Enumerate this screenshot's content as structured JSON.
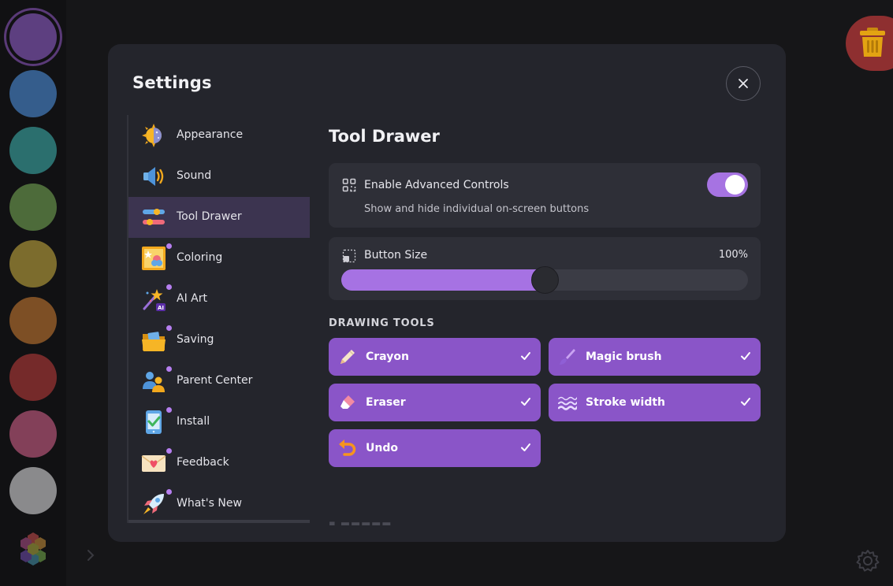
{
  "palette": {
    "swatches": [
      {
        "name": "purple",
        "color": "#5d3f80",
        "selected": true
      },
      {
        "name": "blue",
        "color": "#355d8c"
      },
      {
        "name": "teal",
        "color": "#2b6f6e"
      },
      {
        "name": "green",
        "color": "#4d6b3a"
      },
      {
        "name": "olive",
        "color": "#7c6c2d"
      },
      {
        "name": "orange",
        "color": "#7d4f25"
      },
      {
        "name": "red",
        "color": "#752a2a"
      },
      {
        "name": "pink",
        "color": "#834059"
      },
      {
        "name": "gray",
        "color": "#8a8a8c"
      }
    ]
  },
  "settings": {
    "title": "Settings",
    "nav": [
      {
        "label": "Appearance",
        "icon": "day-night-icon",
        "dot": false,
        "active": false
      },
      {
        "label": "Sound",
        "icon": "speaker-icon",
        "dot": false,
        "active": false
      },
      {
        "label": "Tool Drawer",
        "icon": "sliders-icon",
        "dot": false,
        "active": true
      },
      {
        "label": "Coloring",
        "icon": "coloring-book-icon",
        "dot": true,
        "active": false
      },
      {
        "label": "AI Art",
        "icon": "magic-wand-icon",
        "dot": true,
        "active": false
      },
      {
        "label": "Saving",
        "icon": "folder-icon",
        "dot": true,
        "active": false
      },
      {
        "label": "Parent Center",
        "icon": "parents-icon",
        "dot": true,
        "active": false
      },
      {
        "label": "Install",
        "icon": "phone-check-icon",
        "dot": true,
        "active": false
      },
      {
        "label": "Feedback",
        "icon": "envelope-heart-icon",
        "dot": true,
        "active": false
      },
      {
        "label": "What's New",
        "icon": "rocket-icon",
        "dot": true,
        "active": false
      }
    ],
    "content": {
      "title": "Tool Drawer",
      "advanced": {
        "label": "Enable Advanced Controls",
        "description": "Show and hide individual on-screen buttons",
        "enabled": true
      },
      "button_size": {
        "label": "Button Size",
        "value_text": "100%",
        "level": 0.5
      },
      "drawing_tools_heading": "DRAWING TOOLS",
      "tools": [
        {
          "label": "Crayon",
          "icon": "crayon-icon",
          "checked": true
        },
        {
          "label": "Magic brush",
          "icon": "magic-brush-icon",
          "checked": true
        },
        {
          "label": "Eraser",
          "icon": "eraser-icon",
          "checked": true
        },
        {
          "label": "Stroke width",
          "icon": "stroke-width-icon",
          "checked": true
        },
        {
          "label": "Undo",
          "icon": "undo-icon",
          "checked": true
        }
      ]
    }
  },
  "colors": {
    "accent": "#a672e3",
    "tool_bg": "#8a55c8",
    "modal_bg": "#24252c"
  }
}
